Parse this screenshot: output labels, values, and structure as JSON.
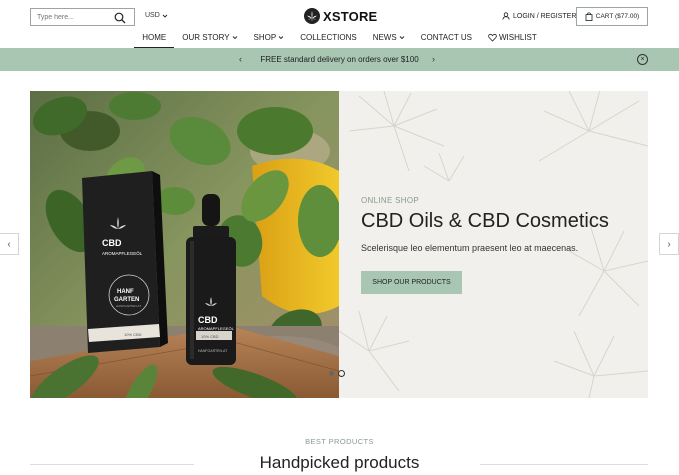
{
  "header": {
    "search": {
      "placeholder": "Type here..."
    },
    "currency": "USD",
    "logo_text": "XSTORE",
    "login_label": "LOGIN / REGISTER",
    "cart_label": "CART ($77.00)"
  },
  "nav": {
    "items": [
      {
        "label": "HOME",
        "dropdown": false,
        "active": true
      },
      {
        "label": "OUR STORY",
        "dropdown": true
      },
      {
        "label": "SHOP",
        "dropdown": true
      },
      {
        "label": "COLLECTIONS",
        "dropdown": false
      },
      {
        "label": "NEWS",
        "dropdown": true
      },
      {
        "label": "CONTACT US",
        "dropdown": false
      },
      {
        "label": "WISHLIST",
        "dropdown": false,
        "icon": "heart-icon"
      }
    ]
  },
  "promo": {
    "text": "FREE standard delivery on orders over $100"
  },
  "hero": {
    "eyebrow": "ONLINE SHOP",
    "title": "CBD Oils & CBD Cosmetics",
    "subtitle": "Scelerisque leo elementum praesent leo at maecenas.",
    "cta_label": "SHOP OUR PRODUCTS",
    "box_brand": "CBD",
    "box_sub": "AROMAPFLEGEÖL",
    "box_seal_line1": "HANF",
    "box_seal_line2": "GARTEN",
    "box_seal_ring": "HANFGARTEN.AT",
    "box_strip": "10% CBD",
    "bottle_brand": "CBD",
    "bottle_sub": "AROMAPFLEGEÖL",
    "bottle_strip": "10% CBD",
    "bottle_footer": "HANFGARTEN.AT"
  },
  "section": {
    "eyebrow": "BEST PRODUCTS",
    "title": "Handpicked products"
  },
  "colors": {
    "accent": "#a9c6b3",
    "hero_text_bg": "#f2f0ec"
  }
}
